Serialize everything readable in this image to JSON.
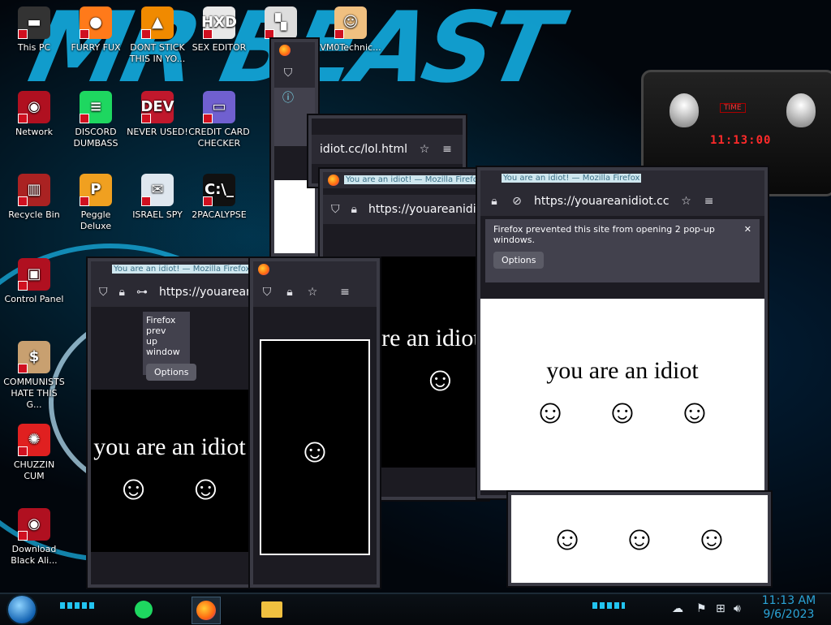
{
  "wallpaper": {
    "text": "MR BEAST"
  },
  "desktop_icons": [
    {
      "label": "This PC",
      "glyph": "▬",
      "color": "#333"
    },
    {
      "label": "FURRY FUX",
      "glyph": "●",
      "color": "#ff7a1a"
    },
    {
      "label": "DONT STICK THIS IN YO...",
      "glyph": "▲",
      "color": "#f08a00"
    },
    {
      "label": "SEX EDITOR",
      "glyph": "HXD",
      "color": "#e8e8e8"
    },
    {
      "label": "",
      "glyph": "▚",
      "color": "#ddd"
    },
    {
      "label": "VM0Technic...",
      "glyph": "☺",
      "color": "#f0c080"
    },
    {
      "label": "Network",
      "glyph": "◉",
      "color": "#b01020"
    },
    {
      "label": "DISCORD DUMBASS",
      "glyph": "≡",
      "color": "#1ed760"
    },
    {
      "label": "NEVER USED!",
      "glyph": "DEV",
      "color": "#c0182c"
    },
    {
      "label": "CREDIT CARD CHECKER",
      "glyph": "▭",
      "color": "#7060d0"
    },
    {
      "label": "Recycle Bin",
      "glyph": "▥",
      "color": "#aa2222"
    },
    {
      "label": "Peggle Deluxe",
      "glyph": "P",
      "color": "#f0a020"
    },
    {
      "label": "ISRAEL SPY",
      "glyph": "✉",
      "color": "#dfe7ef"
    },
    {
      "label": "2PACALYPSE",
      "glyph": "C:\\_",
      "color": "#111"
    },
    {
      "label": "Control Panel",
      "glyph": "▣",
      "color": "#b01020"
    },
    {
      "label": "COMMUNISTS HATE THIS G...",
      "glyph": "$",
      "color": "#c8a070"
    },
    {
      "label": "CHUZZIN CUM",
      "glyph": "✺",
      "color": "#e02020"
    },
    {
      "label": "Download Black Ali...",
      "glyph": "◉",
      "color": "#b01020"
    }
  ],
  "alien_widget": {
    "label": "TIME",
    "time": "11:13:00"
  },
  "notification": {
    "message_short": "Firefox prev",
    "message_short2": "up window",
    "message_full": "Firefox prevented this site from opening 2 pop-up windows.",
    "options": "Options"
  },
  "windows": {
    "title": "You are an idiot! — Mozilla Firefox",
    "url": "https://youareanidiot.cc",
    "url_path": "idiot.cc/lol.html",
    "page_text": "you are an idiot",
    "face": "☺"
  },
  "taskbar": {
    "time": "11:13 AM",
    "date": "9/6/2023"
  }
}
